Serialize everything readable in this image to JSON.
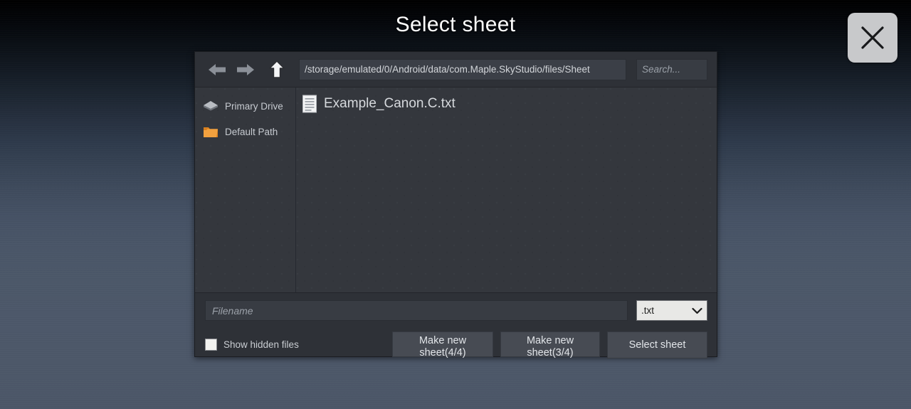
{
  "window": {
    "title": "Select sheet",
    "close_label": "close-icon"
  },
  "toolbar": {
    "back_icon": "arrow-left-icon",
    "forward_icon": "arrow-right-icon",
    "up_icon": "arrow-up-icon",
    "path_value": "/storage/emulated/0/Android/data/com.Maple.SkyStudio/files/Sheet",
    "search_placeholder": "Search...",
    "search_value": ""
  },
  "sidebar": {
    "items": [
      {
        "label": "Primary Drive",
        "icon": "drive-icon"
      },
      {
        "label": "Default Path",
        "icon": "folder-icon"
      }
    ]
  },
  "file_list": {
    "files": [
      {
        "name": "Example_Canon.C.txt",
        "icon": "text-file-icon"
      }
    ]
  },
  "footer": {
    "filename_placeholder": "Filename",
    "filename_value": "",
    "filetype_selected": ".txt",
    "filetype_options": [
      ".txt"
    ],
    "show_hidden_label": "Show hidden files",
    "show_hidden_checked": false,
    "make_new_sheet_4": "Make new sheet(4/4)",
    "make_new_sheet_3": "Make new sheet(3/4)",
    "select_sheet": "Select sheet"
  },
  "colors": {
    "dialog_bg": "#2f3238",
    "panel_bg": "#34373d",
    "field_bg": "#383c43",
    "button_bg": "#474b53",
    "text": "#d3d6da",
    "folder_accent": "#e8963c",
    "close_bg": "#c8c9cb"
  }
}
